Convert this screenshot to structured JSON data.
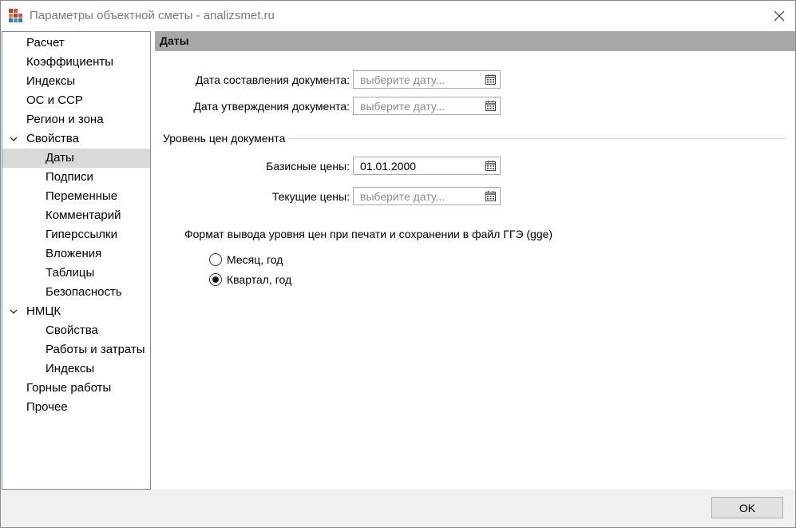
{
  "window": {
    "title": "Параметры объектной сметы - analizsmet.ru"
  },
  "sidebar": {
    "items": [
      {
        "label": "Расчет"
      },
      {
        "label": "Коэффициенты"
      },
      {
        "label": "Индексы"
      },
      {
        "label": "ОС и ССР"
      },
      {
        "label": "Регион и зона"
      },
      {
        "label": "Свойства",
        "expanded": true
      },
      {
        "label": "Даты",
        "selected": true
      },
      {
        "label": "Подписи"
      },
      {
        "label": "Переменные"
      },
      {
        "label": "Комментарий"
      },
      {
        "label": "Гиперссылки"
      },
      {
        "label": "Вложения"
      },
      {
        "label": "Таблицы"
      },
      {
        "label": "Безопасность"
      },
      {
        "label": "НМЦК",
        "expanded": true
      },
      {
        "label": "Свойства"
      },
      {
        "label": "Работы и затраты"
      },
      {
        "label": "Индексы"
      },
      {
        "label": "Горные работы"
      },
      {
        "label": "Прочее"
      }
    ]
  },
  "content": {
    "header": "Даты",
    "doc_created": {
      "label": "Дата составления документа:",
      "value": "",
      "placeholder": "выберите дату..."
    },
    "doc_approved": {
      "label": "Дата утверждения документа:",
      "value": "",
      "placeholder": "выберите дату..."
    },
    "price_level_title": "Уровень цен документа",
    "base_prices": {
      "label": "Базисные цены:",
      "value": "01.01.2000",
      "placeholder": "выберите дату..."
    },
    "current_prices": {
      "label": "Текущие цены:",
      "value": "",
      "placeholder": "выберите дату..."
    },
    "format_label": "Формат вывода уровня цен при печати и сохранении в файл ГГЭ (gge)",
    "radio_month": {
      "label": "Месяц, год",
      "checked": false
    },
    "radio_quarter": {
      "label": "Квартал, год",
      "checked": true
    }
  },
  "footer": {
    "ok_label": "OK"
  },
  "colors": {
    "header_bg": "#a8a8a8",
    "selected_bg": "#d9d9d9",
    "footer_bg": "#f0f0f0"
  }
}
